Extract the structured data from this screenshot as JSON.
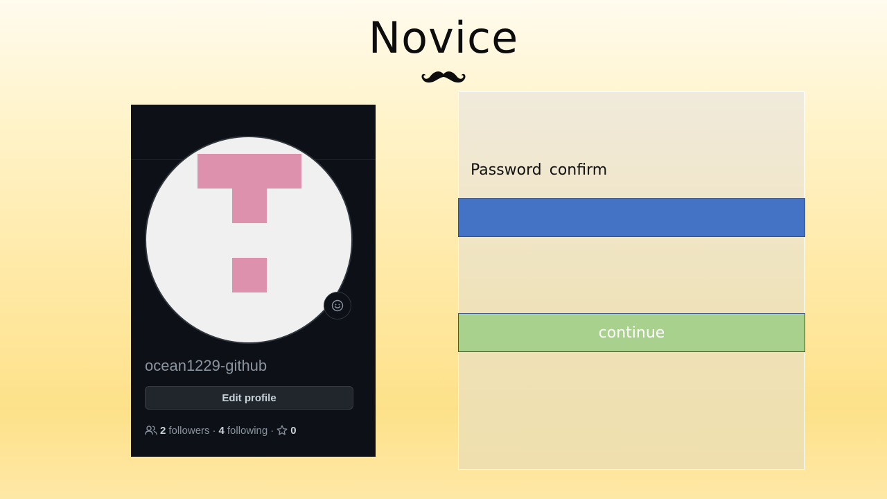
{
  "slide": {
    "title": "Novice"
  },
  "profile": {
    "username": "ocean1229-github",
    "edit_button_label": "Edit profile",
    "followers_count": "2",
    "followers_label": "followers",
    "separator": "·",
    "following_count": "4",
    "following_label": "following",
    "stars_count": "0",
    "colors": {
      "card_bg": "#0d1117",
      "avatar_bg": "#f0f0f1",
      "avatar_pixels": "#de91ad"
    },
    "icons": [
      "smiley-icon",
      "people-icon",
      "star-icon"
    ]
  },
  "form": {
    "password_confirm_label": "Password  confirm",
    "password_input_value": "",
    "continue_label": "continue",
    "colors": {
      "input_bg": "#4472c4",
      "continue_bg": "#a9d18e"
    }
  }
}
